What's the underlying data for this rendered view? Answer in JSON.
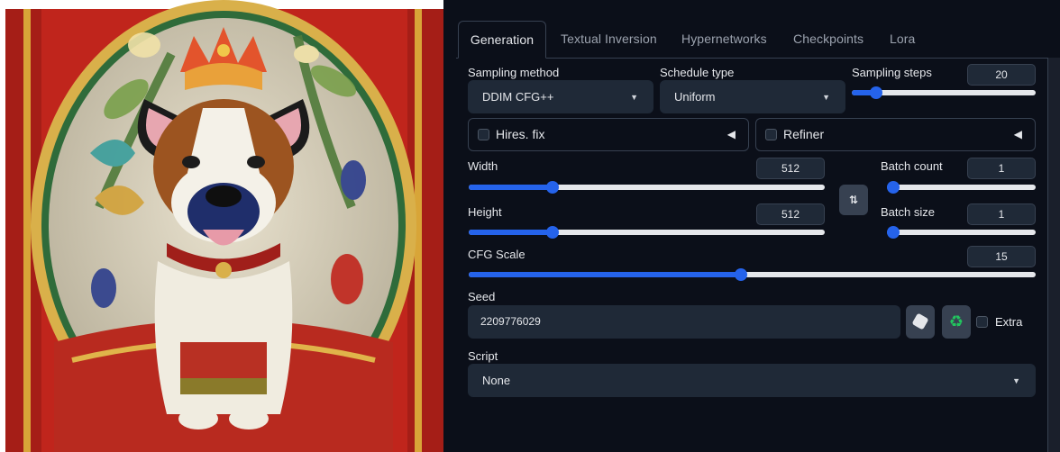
{
  "tabs": [
    {
      "label": "Generation",
      "active": true
    },
    {
      "label": "Textual Inversion",
      "active": false
    },
    {
      "label": "Hypernetworks",
      "active": false
    },
    {
      "label": "Checkpoints",
      "active": false
    },
    {
      "label": "Lora",
      "active": false
    }
  ],
  "sampling_method": {
    "label": "Sampling method",
    "value": "DDIM CFG++"
  },
  "schedule_type": {
    "label": "Schedule type",
    "value": "Uniform"
  },
  "sampling_steps": {
    "label": "Sampling steps",
    "value": "20",
    "fraction": 0.13
  },
  "hires_fix": {
    "label": "Hires. fix",
    "checked": false
  },
  "refiner": {
    "label": "Refiner",
    "checked": false
  },
  "width": {
    "label": "Width",
    "value": "512",
    "fraction": 0.235
  },
  "height": {
    "label": "Height",
    "value": "512",
    "fraction": 0.235
  },
  "swap_button": {
    "icon": "swap-vertical-icon",
    "glyph": "⇅"
  },
  "batch_count": {
    "label": "Batch count",
    "value": "1",
    "fraction": 0.0
  },
  "batch_size": {
    "label": "Batch size",
    "value": "1",
    "fraction": 0.0
  },
  "cfg_scale": {
    "label": "CFG Scale",
    "value": "15",
    "fraction": 0.48
  },
  "seed": {
    "label": "Seed",
    "value": "2209776029",
    "dice_icon": "dice-icon",
    "recycle_icon": "recycle-icon",
    "extra_label": "Extra"
  },
  "script": {
    "label": "Script",
    "value": "None"
  },
  "colors": {
    "accent": "#2563eb",
    "panel_bg": "#0b0f19",
    "input_bg": "#1f2937",
    "border": "#374151",
    "recycle": "#22c55e"
  }
}
